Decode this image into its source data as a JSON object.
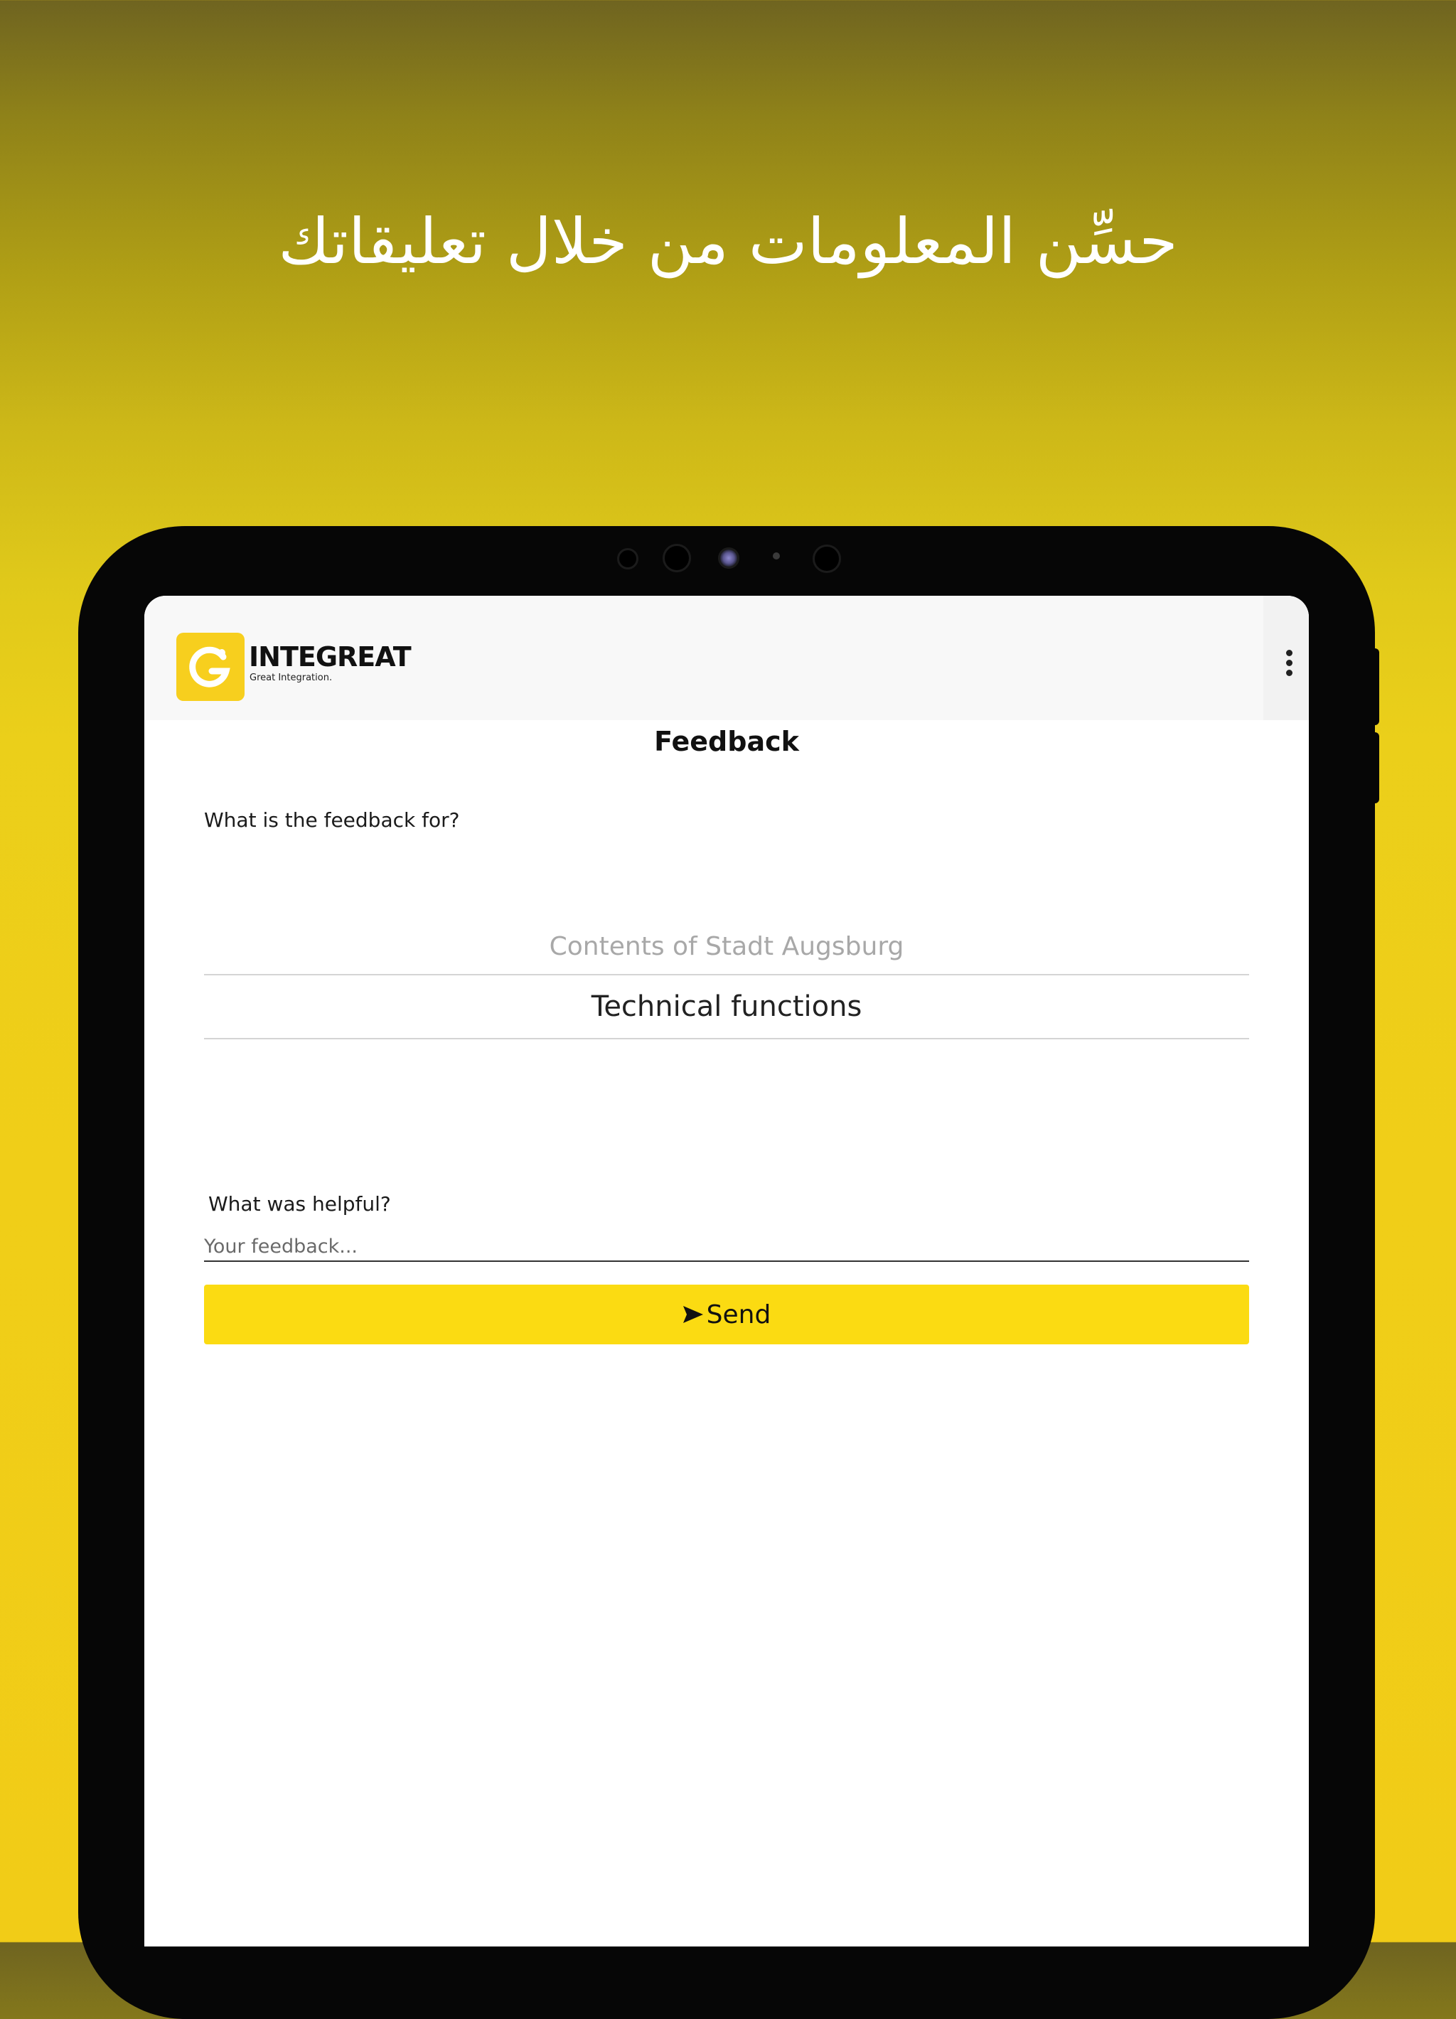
{
  "promo": {
    "headline": "حسِّن المعلومات من خلال تعليقاتك"
  },
  "header": {
    "brand": "INTEGREAT",
    "tagline": "Great Integration.",
    "menu_icon": "kebab-menu-icon"
  },
  "page": {
    "title": "Feedback"
  },
  "form": {
    "question_for": "What is the feedback for?",
    "options": [
      "Contents of Stadt Augsburg",
      "Technical functions"
    ],
    "selected_option": "Technical functions",
    "question_helpful": "What was helpful?",
    "feedback_placeholder": "Your feedback...",
    "feedback_value": "",
    "send_label": "Send",
    "send_icon": "send-arrow-icon"
  },
  "colors": {
    "accent": "#fbdb12",
    "logo_yellow": "#f7cf1e",
    "background_top": "#6f6420",
    "background_bottom": "#f1cc17"
  }
}
